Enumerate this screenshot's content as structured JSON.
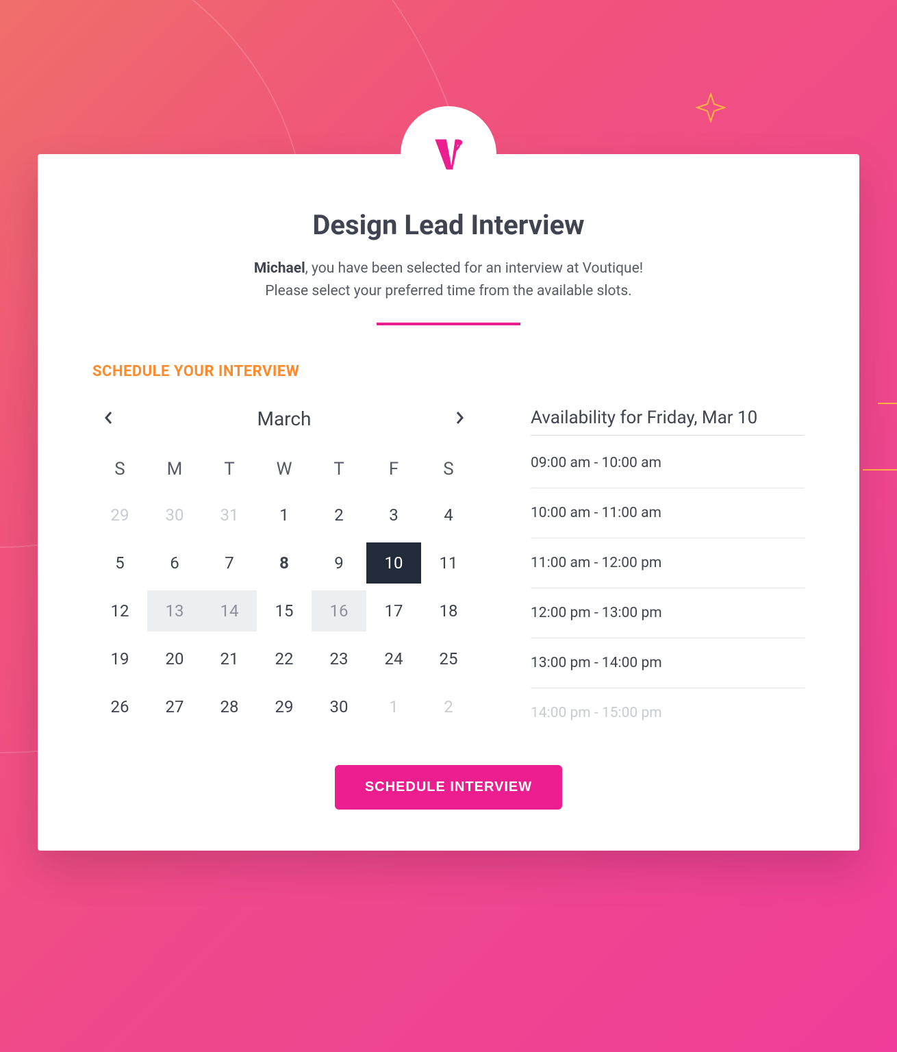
{
  "colors": {
    "accent": "#ec1d8f",
    "sectionLabel": "#ff8a2b",
    "dark": "#222b3a"
  },
  "header": {
    "title": "Design Lead Interview",
    "candidateName": "Michael",
    "introSuffix": ", you have been selected for an interview at Voutique!",
    "introLine2": "Please select your preferred time from the available slots."
  },
  "sectionLabel": "SCHEDULE YOUR INTERVIEW",
  "calendar": {
    "month": "March",
    "dow": [
      "S",
      "M",
      "T",
      "W",
      "T",
      "F",
      "S"
    ],
    "days": [
      {
        "n": "29",
        "outside": true
      },
      {
        "n": "30",
        "outside": true
      },
      {
        "n": "31",
        "outside": true
      },
      {
        "n": "1"
      },
      {
        "n": "2"
      },
      {
        "n": "3"
      },
      {
        "n": "4"
      },
      {
        "n": "5"
      },
      {
        "n": "6"
      },
      {
        "n": "7"
      },
      {
        "n": "8",
        "today": true
      },
      {
        "n": "9"
      },
      {
        "n": "10",
        "selected": true
      },
      {
        "n": "11"
      },
      {
        "n": "12"
      },
      {
        "n": "13",
        "unavail": true
      },
      {
        "n": "14",
        "unavail": true
      },
      {
        "n": "15"
      },
      {
        "n": "16",
        "unavail": true
      },
      {
        "n": "17"
      },
      {
        "n": "18"
      },
      {
        "n": "19"
      },
      {
        "n": "20"
      },
      {
        "n": "21"
      },
      {
        "n": "22"
      },
      {
        "n": "23"
      },
      {
        "n": "24"
      },
      {
        "n": "25"
      },
      {
        "n": "26"
      },
      {
        "n": "27"
      },
      {
        "n": "28"
      },
      {
        "n": "29"
      },
      {
        "n": "30"
      },
      {
        "n": "1",
        "outside": true
      },
      {
        "n": "2",
        "outside": true
      }
    ]
  },
  "availability": {
    "title": "Availability for Friday, Mar 10",
    "slots": [
      "09:00 am - 10:00 am",
      "10:00 am - 11:00 am",
      "11:00 am - 12:00 pm",
      "12:00 pm - 13:00 pm",
      "13:00 pm - 14:00 pm",
      "14:00 pm - 15:00 pm"
    ]
  },
  "cta": {
    "label": "SCHEDULE INTERVIEW"
  }
}
